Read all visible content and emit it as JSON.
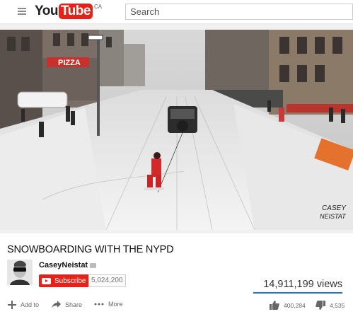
{
  "masthead": {
    "logo_you": "You",
    "logo_tube": "Tube",
    "region": "CA",
    "search_placeholder": "Search"
  },
  "video": {
    "watermark_line1": "CASEY",
    "watermark_line2": "NEISTAT",
    "storefront_sign": "PIZZA"
  },
  "info": {
    "title": "SNOWBOARDING WITH THE NYPD",
    "channel": "CaseyNeistat",
    "subscribe_label": "Subscribe",
    "subscriber_count": "5,024,200",
    "views": "14,911,199 views",
    "actions": {
      "add_to": "Add to",
      "share": "Share",
      "more": "More",
      "likes": "400,284",
      "dislikes": "4,535"
    }
  },
  "colors": {
    "brand_red": "#e62117",
    "link_blue": "#167ac6"
  }
}
